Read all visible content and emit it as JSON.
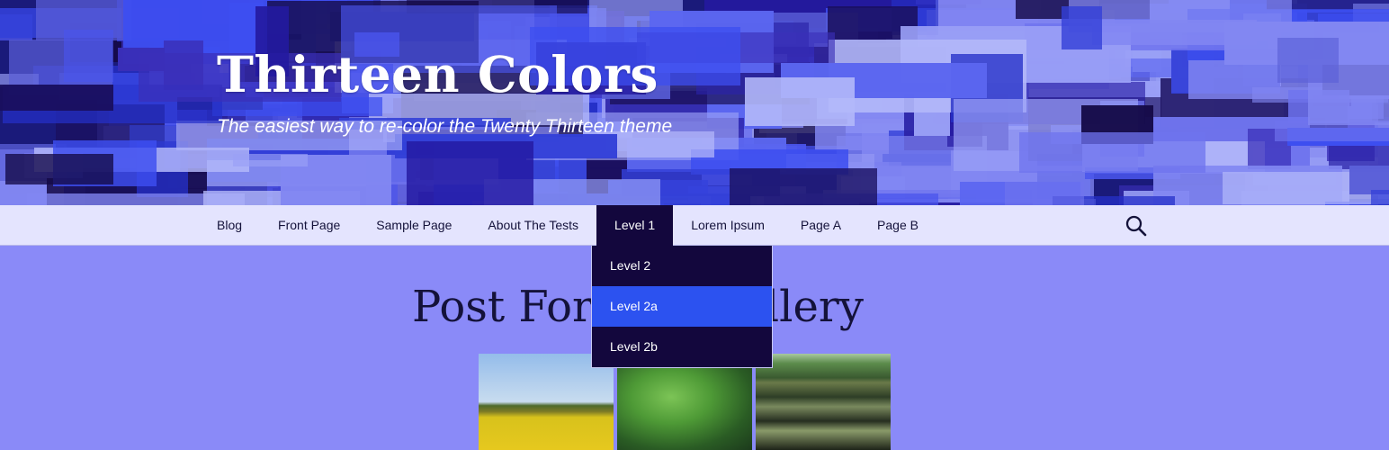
{
  "site": {
    "title": "Thirteen Colors",
    "description": "The easiest way to re-color the Twenty Thirteen theme"
  },
  "nav": {
    "items": [
      {
        "label": "Blog"
      },
      {
        "label": "Front Page"
      },
      {
        "label": "Sample Page"
      },
      {
        "label": "About The Tests"
      },
      {
        "label": "Level 1",
        "active": true
      },
      {
        "label": "Lorem Ipsum"
      },
      {
        "label": "Page A"
      },
      {
        "label": "Page B"
      }
    ],
    "search_icon": "search-icon"
  },
  "dropdown": {
    "items": [
      {
        "label": "Level 2"
      },
      {
        "label": "Level 2a",
        "hovered": true
      },
      {
        "label": "Level 2b"
      }
    ]
  },
  "post": {
    "title": "Post Format: Gallery",
    "gallery": [
      {
        "subject": "canola field"
      },
      {
        "subject": "green plant leaves"
      },
      {
        "subject": "vegetable rows"
      }
    ]
  },
  "colors": {
    "page_background": "#8a8af8",
    "navbar_background": "#e4e4fe",
    "active_background": "#13073d",
    "hover_background": "#2c52f0",
    "text": "#14123a"
  }
}
